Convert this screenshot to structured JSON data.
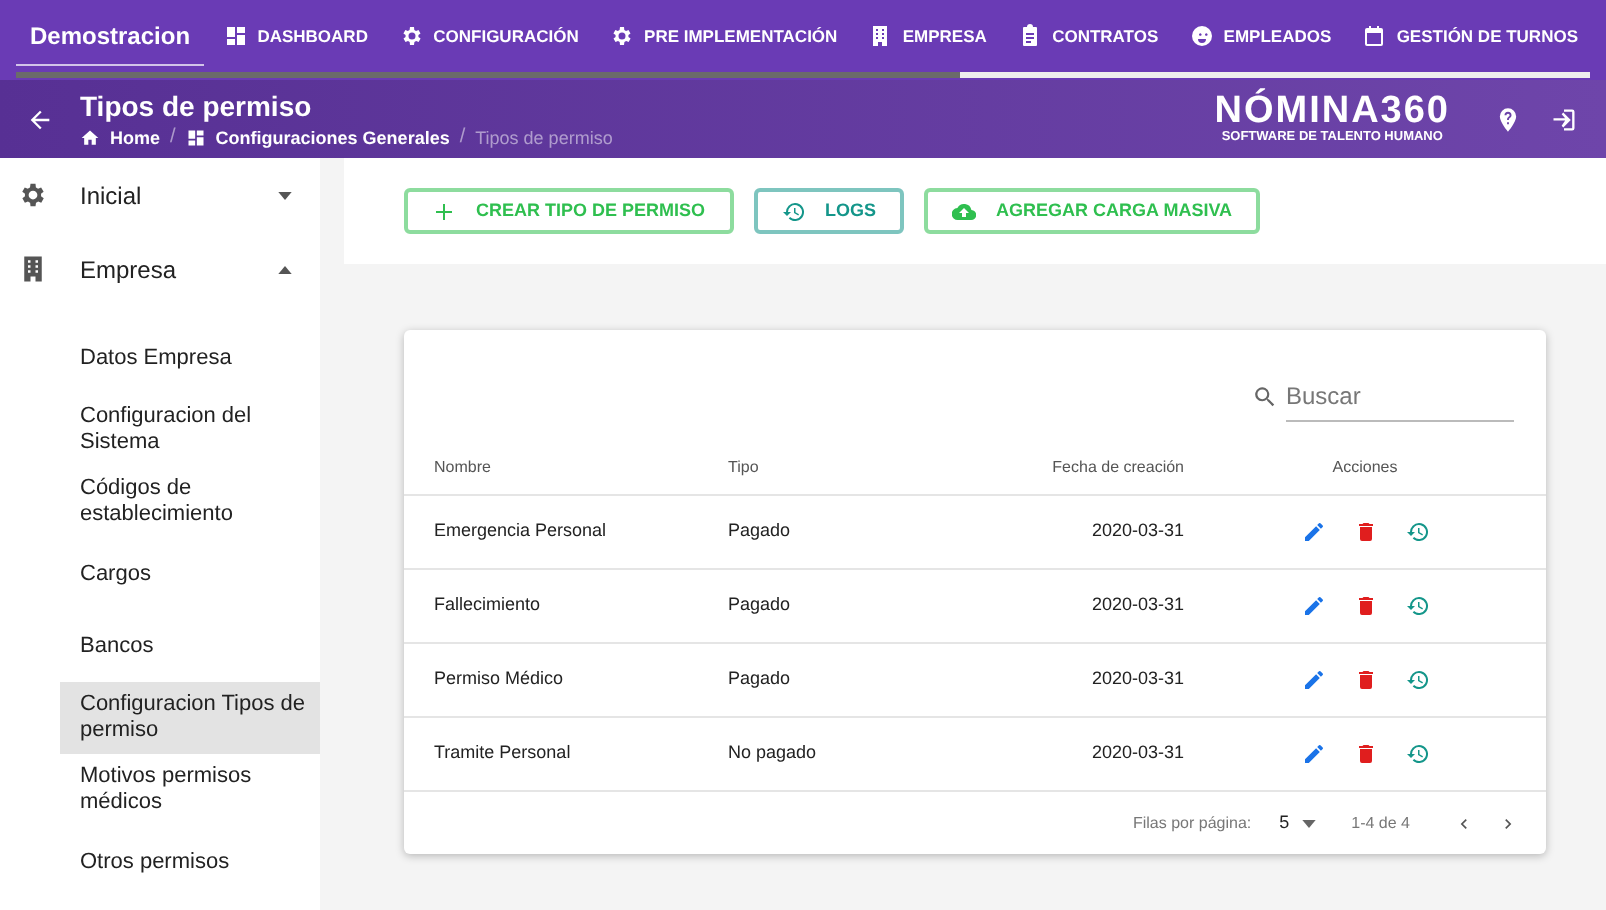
{
  "nav": {
    "brand": "Demostracion",
    "brand_selected": true,
    "items": [
      {
        "label": "DASHBOARD"
      },
      {
        "label": "CONFIGURACIÓN"
      },
      {
        "label": "PRE IMPLEMENTACIÓN"
      },
      {
        "label": "EMPRESA"
      },
      {
        "label": "CONTRATOS"
      },
      {
        "label": "EMPLEADOS"
      },
      {
        "label": "GESTIÓN DE TURNOS"
      }
    ]
  },
  "loading_bar": {
    "level": 0.6
  },
  "header": {
    "title": "Tipos de permiso",
    "breadcrumbs": [
      {
        "label": "Home"
      },
      {
        "separator": "/",
        "label": "Configuraciones Generales"
      },
      {
        "separator": "/",
        "label": "Tipos de permiso"
      }
    ],
    "logo": {
      "name": "NÓMINA360",
      "tagline": "SOFTWARE DE TALENTO HUMANO"
    }
  },
  "sidebar": {
    "items": [
      {
        "label": "Inicial",
        "expanded": false
      },
      {
        "label": "Empresa",
        "expanded": true,
        "children": [
          {
            "label": "Datos Empresa",
            "selected": false
          },
          {
            "label": "Configuracion del Sistema",
            "selected": false
          },
          {
            "label": "Códigos de establecimiento",
            "selected": false
          },
          {
            "label": "Cargos",
            "selected": false
          },
          {
            "label": "Bancos",
            "selected": false
          },
          {
            "label": "Configuracion Tipos de permiso",
            "selected": true
          },
          {
            "label": "Motivos permisos médicos",
            "selected": false
          },
          {
            "label": "Otros permisos",
            "selected": false
          }
        ]
      }
    ]
  },
  "toolbar": {
    "buttons": [
      {
        "label": "CREAR TIPO DE PERMISO"
      },
      {
        "label": "LOGS"
      },
      {
        "label": "AGREGAR CARGA MASIVA"
      }
    ]
  },
  "table": {
    "search": {
      "placeholder": "Buscar"
    },
    "columns": [
      "Nombre",
      "Tipo",
      "Fecha de creación",
      "Acciones"
    ],
    "rows": [
      {
        "nombre": "Emergencia Personal",
        "tipo": "Pagado",
        "fecha": "2020-03-31"
      },
      {
        "nombre": "Fallecimiento",
        "tipo": "Pagado",
        "fecha": "2020-03-31"
      },
      {
        "nombre": "Permiso Médico",
        "tipo": "Pagado",
        "fecha": "2020-03-31"
      },
      {
        "nombre": "Tramite Personal",
        "tipo": "No pagado",
        "fecha": "2020-03-31"
      }
    ],
    "pagination": {
      "rows_label": "Filas por página:",
      "rows_per_page": "5",
      "range": "1-4 de 4"
    }
  }
}
